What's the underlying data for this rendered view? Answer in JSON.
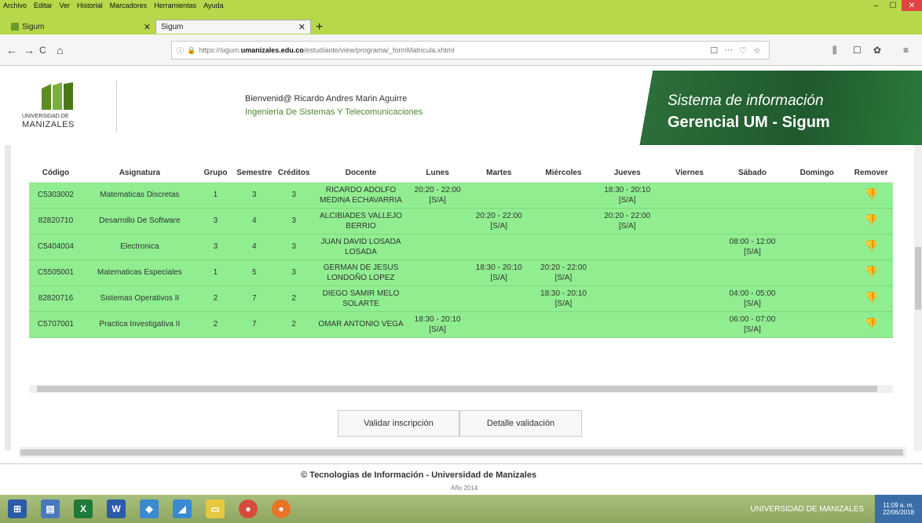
{
  "menubar": [
    "Archivo",
    "Editar",
    "Ver",
    "Historial",
    "Marcadores",
    "Herramientas",
    "Ayuda"
  ],
  "window_controls": {
    "minimize": "–",
    "restore": "☐",
    "close": "✕"
  },
  "tabs": [
    {
      "label": "Sigum",
      "close": "✕"
    },
    {
      "label": "Sigum",
      "close": "✕"
    }
  ],
  "newtab": "+",
  "nav": {
    "back": "←",
    "forward": "→",
    "reload": "C",
    "home": "⌂",
    "url_prefix": "https://sigum.",
    "url_host": "umanizales.edu.co",
    "url_path": "/estudiante/view/programa/_formMatricula.xhtml",
    "right_icons": [
      "☐",
      "···",
      "♡",
      "☆"
    ],
    "toolbar_icons": [
      "⫼",
      "☐",
      "✿",
      "≡"
    ]
  },
  "header": {
    "logo_line1": "UNIVERSIDAD DE",
    "logo_line2": "MANIZALES",
    "welcome": "Bienvenid@ Ricardo Andres Marin Aguirre",
    "program": "Ingeniería De Sistemas Y Telecomunicaciones",
    "banner_line1": "Sistema de información",
    "banner_line2": "Gerencial UM - Sigum"
  },
  "table": {
    "headers": [
      "Código",
      "Asignatura",
      "Grupo",
      "Semestre",
      "Créditos",
      "Docente",
      "Lunes",
      "Martes",
      "Miércoles",
      "Jueves",
      "Viernes",
      "Sábado",
      "Domingo",
      "Remover"
    ],
    "rows": [
      [
        "C5303002",
        "Matematicas Discretas",
        "1",
        "3",
        "3",
        "RICARDO ADOLFO MEDINA ECHAVARRIA",
        "20:20 - 22:00 [S/A]",
        "",
        "",
        "18:30 - 20:10 [S/A]",
        "",
        "",
        "",
        ""
      ],
      [
        "82820710",
        "Desarrollo De Software",
        "3",
        "4",
        "3",
        "ALCIBIADES VALLEJO BERRIO",
        "",
        "20:20 - 22:00 [S/A]",
        "",
        "20:20 - 22:00 [S/A]",
        "",
        "",
        "",
        ""
      ],
      [
        "C5404004",
        "Electronica",
        "3",
        "4",
        "3",
        "JUAN DAVID LOSADA LOSADA",
        "",
        "",
        "",
        "",
        "",
        "08:00 - 12:00 [S/A]",
        "",
        ""
      ],
      [
        "C5505001",
        "Matematicas Especiales",
        "1",
        "5",
        "3",
        "GERMAN DE JESUS LONDOÑO LOPEZ",
        "",
        "18:30 - 20:10 [S/A]",
        "20:20 - 22:00 [S/A]",
        "",
        "",
        "",
        "",
        ""
      ],
      [
        "82820716",
        "Sistemas Operativos II",
        "2",
        "7",
        "2",
        "DIEGO SAMIR MELO SOLARTE",
        "",
        "",
        "18:30 - 20:10 [S/A]",
        "",
        "",
        "04:00 - 05:00 [S/A]",
        "",
        ""
      ],
      [
        "C5707001",
        "Practica Investigativa II",
        "2",
        "7",
        "2",
        "OMAR ANTONIO VEGA",
        "18:30 - 20:10 [S/A]",
        "",
        "",
        "",
        "",
        "06:00 - 07:00 [S/A]",
        "",
        ""
      ]
    ],
    "remove_icon": "👎"
  },
  "buttons": {
    "validate": "Validar inscripción",
    "detail": "Detalle validación"
  },
  "footer": {
    "copyright": "© Tecnologias de Información - Universidad de Manizales",
    "year": "Año 2014"
  },
  "taskbar": {
    "brand": "UNIVERSIDAD DE MANIZALES",
    "time": "11:09 a. m.",
    "date": "22/06/2018"
  },
  "colors": {
    "chrome_green": "#b7d84a",
    "row_green": "#90ee90",
    "banner_green": "#1f5a2e"
  }
}
